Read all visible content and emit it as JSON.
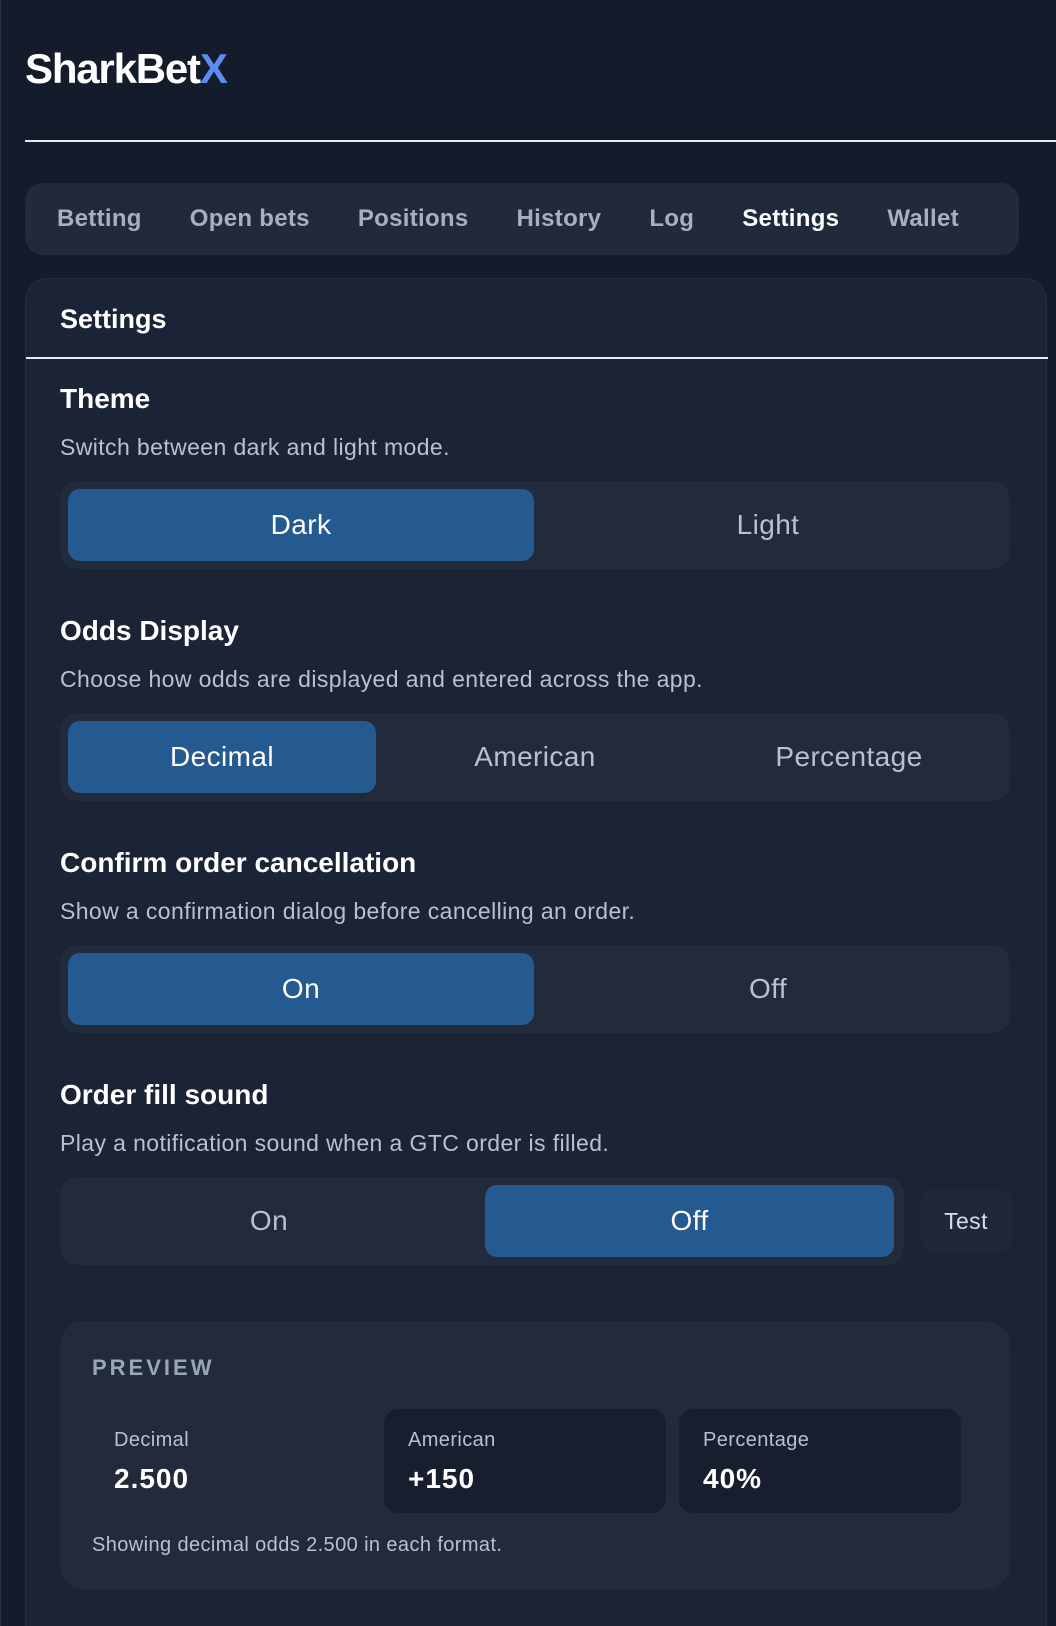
{
  "app": {
    "logo_main": "SharkBet",
    "logo_accent": "X"
  },
  "tabs": [
    {
      "label": "Betting",
      "active": false
    },
    {
      "label": "Open bets",
      "active": false
    },
    {
      "label": "Positions",
      "active": false
    },
    {
      "label": "History",
      "active": false
    },
    {
      "label": "Log",
      "active": false
    },
    {
      "label": "Settings",
      "active": true
    },
    {
      "label": "Wallet",
      "active": false
    }
  ],
  "settings": {
    "title": "Settings",
    "theme": {
      "title": "Theme",
      "description": "Switch between dark and light mode.",
      "options": [
        "Dark",
        "Light"
      ],
      "selected": "Dark"
    },
    "odds_display": {
      "title": "Odds Display",
      "description": "Choose how odds are displayed and entered across the app.",
      "options": [
        "Decimal",
        "American",
        "Percentage"
      ],
      "selected": "Decimal"
    },
    "confirm_cancellation": {
      "title": "Confirm order cancellation",
      "description": "Show a confirmation dialog before cancelling an order.",
      "options": [
        "On",
        "Off"
      ],
      "selected": "On"
    },
    "fill_sound": {
      "title": "Order fill sound",
      "description": "Play a notification sound when a GTC order is filled.",
      "options": [
        "On",
        "Off"
      ],
      "selected": "Off",
      "test_label": "Test"
    },
    "preview": {
      "heading": "PREVIEW",
      "items": [
        {
          "label": "Decimal",
          "value": "2.500"
        },
        {
          "label": "American",
          "value": "+150"
        },
        {
          "label": "Percentage",
          "value": "40%"
        }
      ],
      "note": "Showing decimal odds 2.500 in each format."
    }
  },
  "colors": {
    "background": "#141b2b",
    "card": "#1b2336",
    "selected": "#255a90",
    "logo_accent": "#5b8def"
  }
}
